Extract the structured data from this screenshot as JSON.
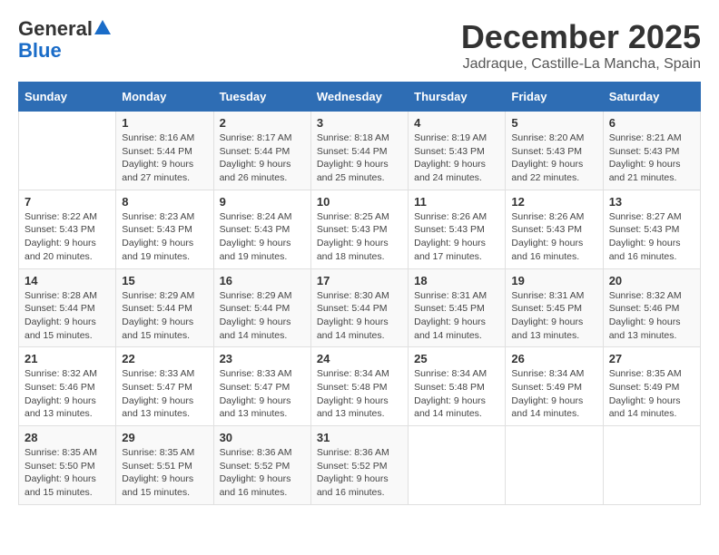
{
  "logo": {
    "general": "General",
    "blue": "Blue"
  },
  "title": "December 2025",
  "subtitle": "Jadraque, Castille-La Mancha, Spain",
  "weekdays": [
    "Sunday",
    "Monday",
    "Tuesday",
    "Wednesday",
    "Thursday",
    "Friday",
    "Saturday"
  ],
  "weeks": [
    [
      {
        "day": "",
        "info": ""
      },
      {
        "day": "1",
        "info": "Sunrise: 8:16 AM\nSunset: 5:44 PM\nDaylight: 9 hours\nand 27 minutes."
      },
      {
        "day": "2",
        "info": "Sunrise: 8:17 AM\nSunset: 5:44 PM\nDaylight: 9 hours\nand 26 minutes."
      },
      {
        "day": "3",
        "info": "Sunrise: 8:18 AM\nSunset: 5:44 PM\nDaylight: 9 hours\nand 25 minutes."
      },
      {
        "day": "4",
        "info": "Sunrise: 8:19 AM\nSunset: 5:43 PM\nDaylight: 9 hours\nand 24 minutes."
      },
      {
        "day": "5",
        "info": "Sunrise: 8:20 AM\nSunset: 5:43 PM\nDaylight: 9 hours\nand 22 minutes."
      },
      {
        "day": "6",
        "info": "Sunrise: 8:21 AM\nSunset: 5:43 PM\nDaylight: 9 hours\nand 21 minutes."
      }
    ],
    [
      {
        "day": "7",
        "info": "Sunrise: 8:22 AM\nSunset: 5:43 PM\nDaylight: 9 hours\nand 20 minutes."
      },
      {
        "day": "8",
        "info": "Sunrise: 8:23 AM\nSunset: 5:43 PM\nDaylight: 9 hours\nand 19 minutes."
      },
      {
        "day": "9",
        "info": "Sunrise: 8:24 AM\nSunset: 5:43 PM\nDaylight: 9 hours\nand 19 minutes."
      },
      {
        "day": "10",
        "info": "Sunrise: 8:25 AM\nSunset: 5:43 PM\nDaylight: 9 hours\nand 18 minutes."
      },
      {
        "day": "11",
        "info": "Sunrise: 8:26 AM\nSunset: 5:43 PM\nDaylight: 9 hours\nand 17 minutes."
      },
      {
        "day": "12",
        "info": "Sunrise: 8:26 AM\nSunset: 5:43 PM\nDaylight: 9 hours\nand 16 minutes."
      },
      {
        "day": "13",
        "info": "Sunrise: 8:27 AM\nSunset: 5:43 PM\nDaylight: 9 hours\nand 16 minutes."
      }
    ],
    [
      {
        "day": "14",
        "info": "Sunrise: 8:28 AM\nSunset: 5:44 PM\nDaylight: 9 hours\nand 15 minutes."
      },
      {
        "day": "15",
        "info": "Sunrise: 8:29 AM\nSunset: 5:44 PM\nDaylight: 9 hours\nand 15 minutes."
      },
      {
        "day": "16",
        "info": "Sunrise: 8:29 AM\nSunset: 5:44 PM\nDaylight: 9 hours\nand 14 minutes."
      },
      {
        "day": "17",
        "info": "Sunrise: 8:30 AM\nSunset: 5:44 PM\nDaylight: 9 hours\nand 14 minutes."
      },
      {
        "day": "18",
        "info": "Sunrise: 8:31 AM\nSunset: 5:45 PM\nDaylight: 9 hours\nand 14 minutes."
      },
      {
        "day": "19",
        "info": "Sunrise: 8:31 AM\nSunset: 5:45 PM\nDaylight: 9 hours\nand 13 minutes."
      },
      {
        "day": "20",
        "info": "Sunrise: 8:32 AM\nSunset: 5:46 PM\nDaylight: 9 hours\nand 13 minutes."
      }
    ],
    [
      {
        "day": "21",
        "info": "Sunrise: 8:32 AM\nSunset: 5:46 PM\nDaylight: 9 hours\nand 13 minutes."
      },
      {
        "day": "22",
        "info": "Sunrise: 8:33 AM\nSunset: 5:47 PM\nDaylight: 9 hours\nand 13 minutes."
      },
      {
        "day": "23",
        "info": "Sunrise: 8:33 AM\nSunset: 5:47 PM\nDaylight: 9 hours\nand 13 minutes."
      },
      {
        "day": "24",
        "info": "Sunrise: 8:34 AM\nSunset: 5:48 PM\nDaylight: 9 hours\nand 13 minutes."
      },
      {
        "day": "25",
        "info": "Sunrise: 8:34 AM\nSunset: 5:48 PM\nDaylight: 9 hours\nand 14 minutes."
      },
      {
        "day": "26",
        "info": "Sunrise: 8:34 AM\nSunset: 5:49 PM\nDaylight: 9 hours\nand 14 minutes."
      },
      {
        "day": "27",
        "info": "Sunrise: 8:35 AM\nSunset: 5:49 PM\nDaylight: 9 hours\nand 14 minutes."
      }
    ],
    [
      {
        "day": "28",
        "info": "Sunrise: 8:35 AM\nSunset: 5:50 PM\nDaylight: 9 hours\nand 15 minutes."
      },
      {
        "day": "29",
        "info": "Sunrise: 8:35 AM\nSunset: 5:51 PM\nDaylight: 9 hours\nand 15 minutes."
      },
      {
        "day": "30",
        "info": "Sunrise: 8:36 AM\nSunset: 5:52 PM\nDaylight: 9 hours\nand 16 minutes."
      },
      {
        "day": "31",
        "info": "Sunrise: 8:36 AM\nSunset: 5:52 PM\nDaylight: 9 hours\nand 16 minutes."
      },
      {
        "day": "",
        "info": ""
      },
      {
        "day": "",
        "info": ""
      },
      {
        "day": "",
        "info": ""
      }
    ]
  ]
}
